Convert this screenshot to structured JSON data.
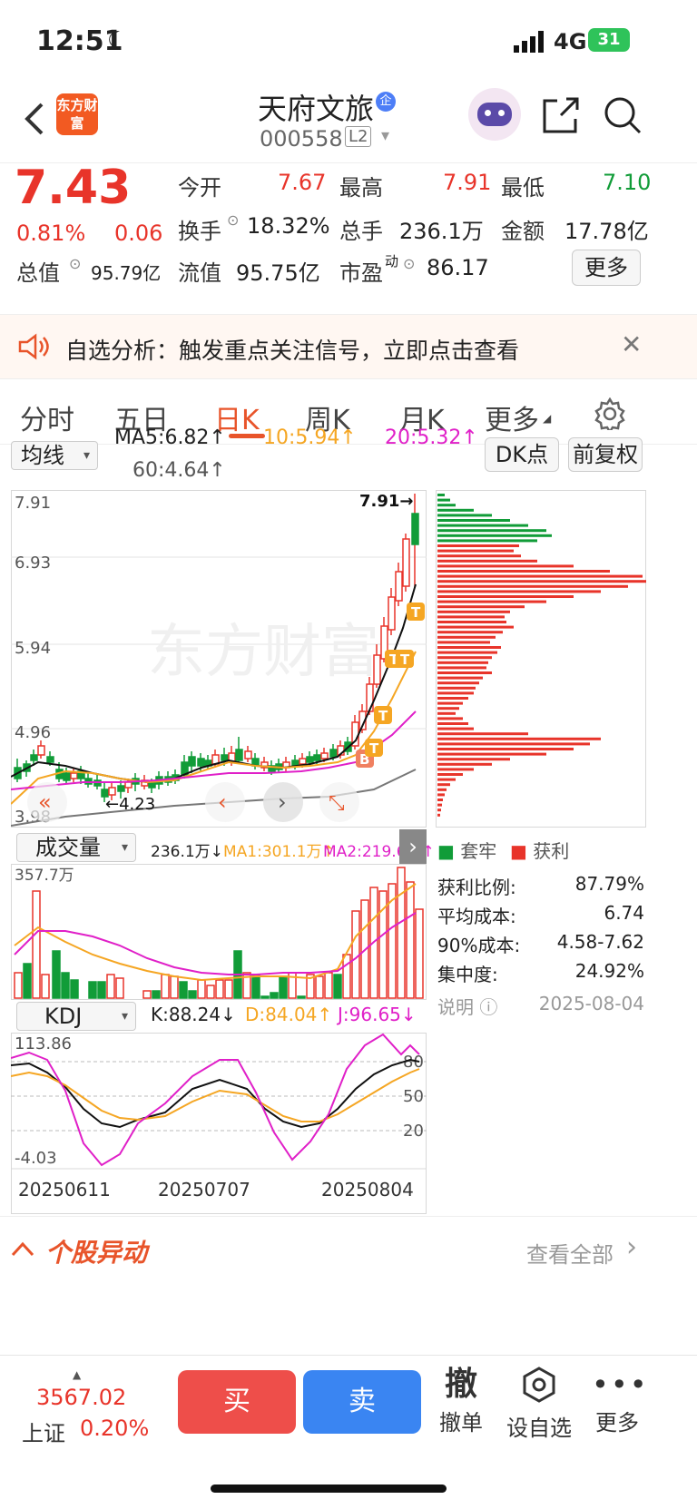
{
  "status": {
    "time": "12:51",
    "network": "4G",
    "battery": "31"
  },
  "header": {
    "logo": "东方财富",
    "title": "天府文旅",
    "badge": "企",
    "code": "000558",
    "level": "L2"
  },
  "quote": {
    "price": "7.43",
    "change_pct": "0.81%",
    "change": "0.06",
    "total_mv_label": "总值",
    "total_mv": "95.79亿",
    "open_label": "今开",
    "open": "7.67",
    "high_label": "最高",
    "high": "7.91",
    "low_label": "最低",
    "low": "7.10",
    "turnover_label": "换手",
    "turnover": "18.32%",
    "volume_label": "总手",
    "volume": "236.1万",
    "amount_label": "金额",
    "amount": "17.78亿",
    "float_mv_label": "流值",
    "float_mv": "95.75亿",
    "pe_label": "市盈",
    "pe_sup": "动",
    "pe": "86.17",
    "more": "更多"
  },
  "banner": {
    "text": "自选分析：触发重点关注信号，立即点击查看"
  },
  "tabs": [
    {
      "label": "分时"
    },
    {
      "label": "五日"
    },
    {
      "label": "日K"
    },
    {
      "label": "周K"
    },
    {
      "label": "月K"
    },
    {
      "label": "更多"
    }
  ],
  "ma": {
    "selector": "均线",
    "ma5": "MA5:6.82↑",
    "ma10": "10:5.94↑",
    "ma20": "20:5.32↑",
    "ma60": "60:4.64↑",
    "dk": "DK点",
    "adjust": "前复权"
  },
  "kline": {
    "y_labels": [
      "7.91",
      "6.93",
      "5.94",
      "4.96",
      "3.98"
    ],
    "max_marker": "7.91→",
    "min_marker": "←4.23",
    "watermark": "东方财富"
  },
  "volume": {
    "selector": "成交量",
    "vol": "236.1万↓",
    "ma1": "MA1:301.1万↑",
    "ma2": "MA2:219.6万↑",
    "max_label": "357.7万"
  },
  "kdj": {
    "selector": "KDJ",
    "k": "K:88.24↓",
    "d": "D:84.04↑",
    "j": "J:96.65↓",
    "max": "113.86",
    "min": "-4.03",
    "levels": [
      "80",
      "50",
      "20"
    ]
  },
  "dates": [
    "20250611",
    "20250707",
    "20250804"
  ],
  "chips": {
    "legend_trapped": "套牢",
    "legend_profit": "获利",
    "rows": [
      {
        "label": "获利比例:",
        "value": "87.79%"
      },
      {
        "label": "平均成本:",
        "value": "6.74"
      },
      {
        "label": "90%成本:",
        "value": "4.58-7.62"
      },
      {
        "label": "集中度:",
        "value": "24.92%"
      }
    ],
    "note": "说明",
    "date": "2025-08-04"
  },
  "movers": {
    "title": "个股异动",
    "link": "查看全部"
  },
  "bottom": {
    "index_value": "3567.02",
    "index_name": "上证",
    "index_pct": "0.20%",
    "buy": "买",
    "sell": "卖",
    "cancel_icon": "撤",
    "cancel": "撤单",
    "watch": "设自选",
    "more": "更多"
  },
  "colors": {
    "up": "#e8342a",
    "down": "#119c38",
    "accent": "#e8542a",
    "ma10": "#f5a623",
    "ma20": "#e020c8",
    "buy": "#ee4e4a",
    "sell": "#3a85f2"
  }
}
